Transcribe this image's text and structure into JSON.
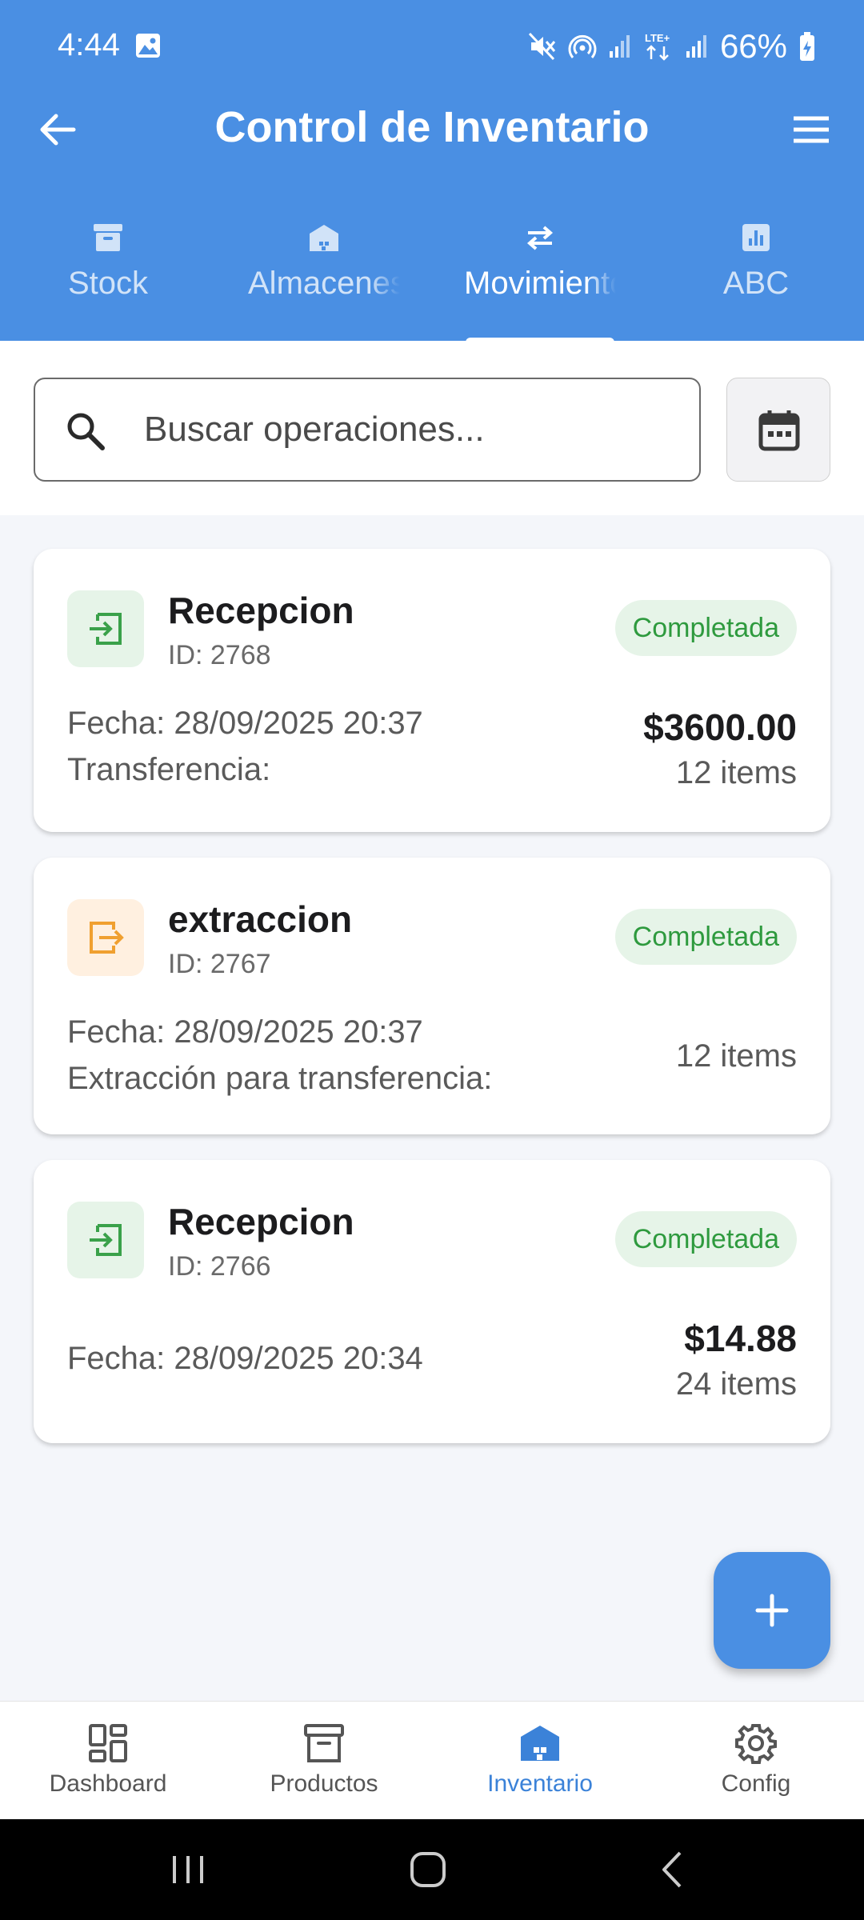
{
  "status_bar": {
    "time": "4:44",
    "battery": "66%",
    "icons": [
      "gallery-icon",
      "mute-icon",
      "hotspot-icon",
      "signal-icon",
      "lte-icon",
      "signal-icon",
      "battery-charging-icon"
    ]
  },
  "header": {
    "title": "Control de Inventario",
    "back_icon": "arrow-left-icon",
    "menu_icon": "menu-icon"
  },
  "tabs": [
    {
      "label": "Stock",
      "icon": "archive-icon",
      "active": false
    },
    {
      "label": "Almacenes",
      "icon": "warehouse-icon",
      "active": false
    },
    {
      "label": "Movimientos",
      "icon": "swap-icon",
      "active": true
    },
    {
      "label": "ABC",
      "icon": "bar-chart-icon",
      "active": false
    }
  ],
  "search": {
    "placeholder": "Buscar operaciones...",
    "value": ""
  },
  "operations": [
    {
      "type": "Recepcion",
      "id": "ID: 2768",
      "status": "Completada",
      "date": "Fecha: 28/09/2025 20:37",
      "description": "Transferencia:",
      "amount": "$3600.00",
      "items": "12 items",
      "kind": "entry"
    },
    {
      "type": "extraccion",
      "id": "ID: 2767",
      "status": "Completada",
      "date": "Fecha: 28/09/2025 20:37",
      "description": "Extracción para transferencia:",
      "amount": "",
      "items": "12 items",
      "kind": "exit"
    },
    {
      "type": "Recepcion",
      "id": "ID: 2766",
      "status": "Completada",
      "date": "Fecha: 28/09/2025 20:34",
      "description": "",
      "amount": "$14.88",
      "items": "24 items",
      "kind": "entry"
    }
  ],
  "bottom_nav": [
    {
      "label": "Dashboard",
      "icon": "dashboard-icon",
      "active": false
    },
    {
      "label": "Productos",
      "icon": "archive-icon",
      "active": false
    },
    {
      "label": "Inventario",
      "icon": "warehouse-icon",
      "active": true
    },
    {
      "label": "Config",
      "icon": "gear-icon",
      "active": false
    }
  ],
  "colors": {
    "primary": "#4a8fe3",
    "status_green": "#2e9a3e",
    "status_green_bg": "#e6f4e8",
    "exit_orange": "#f0a030",
    "exit_orange_bg": "#fff0e0",
    "nav_active": "#3b82d8"
  }
}
